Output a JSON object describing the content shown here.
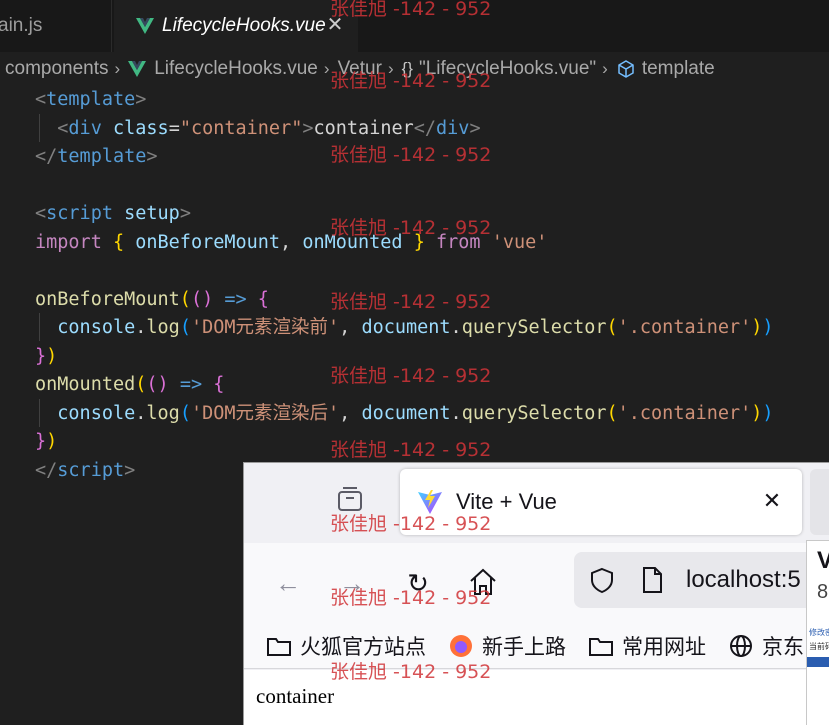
{
  "vscode": {
    "tabs": [
      {
        "label": "ain.js",
        "active": false
      },
      {
        "label": "LifecycleHooks.vue",
        "active": true,
        "close": "✕"
      }
    ],
    "breadcrumb": {
      "folder": "components",
      "file": "LifecycleHooks.vue",
      "vetur": "Vetur",
      "braces": "{}",
      "module": "\"LifecycleHooks.vue\"",
      "node": "template"
    },
    "code": {
      "l1_open": "<",
      "l1_tag": "template",
      "l1_close": ">",
      "l2_open": "<",
      "l2_tag": "div",
      "l2_attr": "class",
      "l2_eq": "=",
      "l2_val": "\"container\"",
      "l2_gt": ">",
      "l2_text": "container",
      "l2_end_open": "</",
      "l2_end_tag": "div",
      "l2_end_gt": ">",
      "l3_open": "</",
      "l3_tag": "template",
      "l3_close": ">",
      "l5_open": "<",
      "l5_tag": "script",
      "l5_attr": "setup",
      "l5_close": ">",
      "l6_import": "import",
      "l6_lb": "{",
      "l6_a": "onBeforeMount",
      "l6_comma": ",",
      "l6_b": "onMounted",
      "l6_rb": "}",
      "l6_from": "from",
      "l6_mod": "'vue'",
      "l8_fn": "onBeforeMount",
      "l8_p1": "(",
      "l8_p2": "()",
      "l8_arrow": "=>",
      "l8_brace": "{",
      "l9_obj": "console",
      "l9_dot": ".",
      "l9_fn": "log",
      "l9_p": "(",
      "l9_str": "'DOM元素渲染前'",
      "l9_comma": ",",
      "l9_doc": "document",
      "l9_dot2": ".",
      "l9_qs": "querySelector",
      "l9_p2": "(",
      "l9_sel": "'.container'",
      "l9_p3": ")",
      "l9_p4": ")",
      "l10_brace": "}",
      "l10_paren": ")",
      "l11_fn": "onMounted",
      "l11_p1": "(",
      "l11_p2": "()",
      "l11_arrow": "=>",
      "l11_brace": "{",
      "l12_obj": "console",
      "l12_dot": ".",
      "l12_fn": "log",
      "l12_p": "(",
      "l12_str": "'DOM元素渲染后'",
      "l12_comma": ",",
      "l12_doc": "document",
      "l12_dot2": ".",
      "l12_qs": "querySelector",
      "l12_p2": "(",
      "l12_sel": "'.container'",
      "l12_p3": ")",
      "l12_p4": ")",
      "l13_brace": "}",
      "l13_paren": ")",
      "l14_open": "</",
      "l14_tag": "script",
      "l14_close": ">"
    }
  },
  "watermark": "张佳旭 -142 - 952",
  "firefox": {
    "tab_title": "Vite + Vue",
    "tab_close": "✕",
    "url": "localhost:5",
    "bookmarks": [
      "火狐官方站点",
      "新手上路",
      "常用网址",
      "京东"
    ],
    "page_text": "container",
    "side_popup": {
      "big": "V",
      "num": "8",
      "small1": "修改密",
      "small2": "当前码"
    }
  },
  "colors": {
    "editor_bg": "#1f1f1f",
    "tag_name": "#569cd6",
    "string": "#ce9178",
    "keyword": "#c586c0",
    "function": "#dcdcaa",
    "variable": "#9cdcfe",
    "watermark": "#d13438",
    "vue_green": "#41b883"
  }
}
